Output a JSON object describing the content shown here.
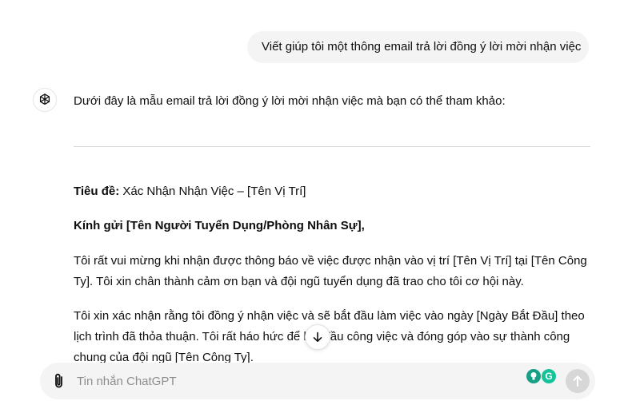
{
  "user_message": "Viết giúp tôi một thông email trả lời đồng ý lời mời nhận việc",
  "assistant": {
    "intro": "Dưới đây là mẫu email trả lời đồng ý lời mời nhận việc mà bạn có thể tham khảo:",
    "email": {
      "subject_label": "Tiêu đề:",
      "subject_value": " Xác Nhận Nhận Việc – [Tên Vị Trí]",
      "salutation": "Kính gửi [Tên Người Tuyển Dụng/Phòng Nhân Sự],",
      "paragraph_1": "Tôi rất vui mừng khi nhận được thông báo về việc được nhận vào vị trí [Tên Vị Trí] tại [Tên Công Ty]. Tôi xin chân thành cảm ơn bạn và đội ngũ tuyển dụng đã trao cho tôi cơ hội này.",
      "paragraph_2": "Tôi xin xác nhận rằng tôi đồng ý nhận việc và sẽ bắt đầu làm việc vào ngày [Ngày Bắt Đầu] theo lịch trình đã thỏa thuận. Tôi rất háo hức để bắt đầu công việc và đóng góp vào sự thành công chung của đội ngũ [Tên Công Ty]."
    }
  },
  "composer": {
    "placeholder": "Tin nhắn ChatGPT",
    "value": ""
  },
  "icons": {
    "avatar": "openai-logo-icon",
    "attach": "paperclip-icon",
    "scroll": "arrow-down-icon",
    "extension_1": "lightbulb-icon",
    "extension_2": "grammarly-icon",
    "send": "arrow-up-icon"
  },
  "extension_2_glyph": "G",
  "colors": {
    "bubble_bg": "#f4f4f4",
    "divider": "#d9d9d9",
    "send_disabled": "#d7d7d7",
    "grammarly": "#15c39a"
  }
}
